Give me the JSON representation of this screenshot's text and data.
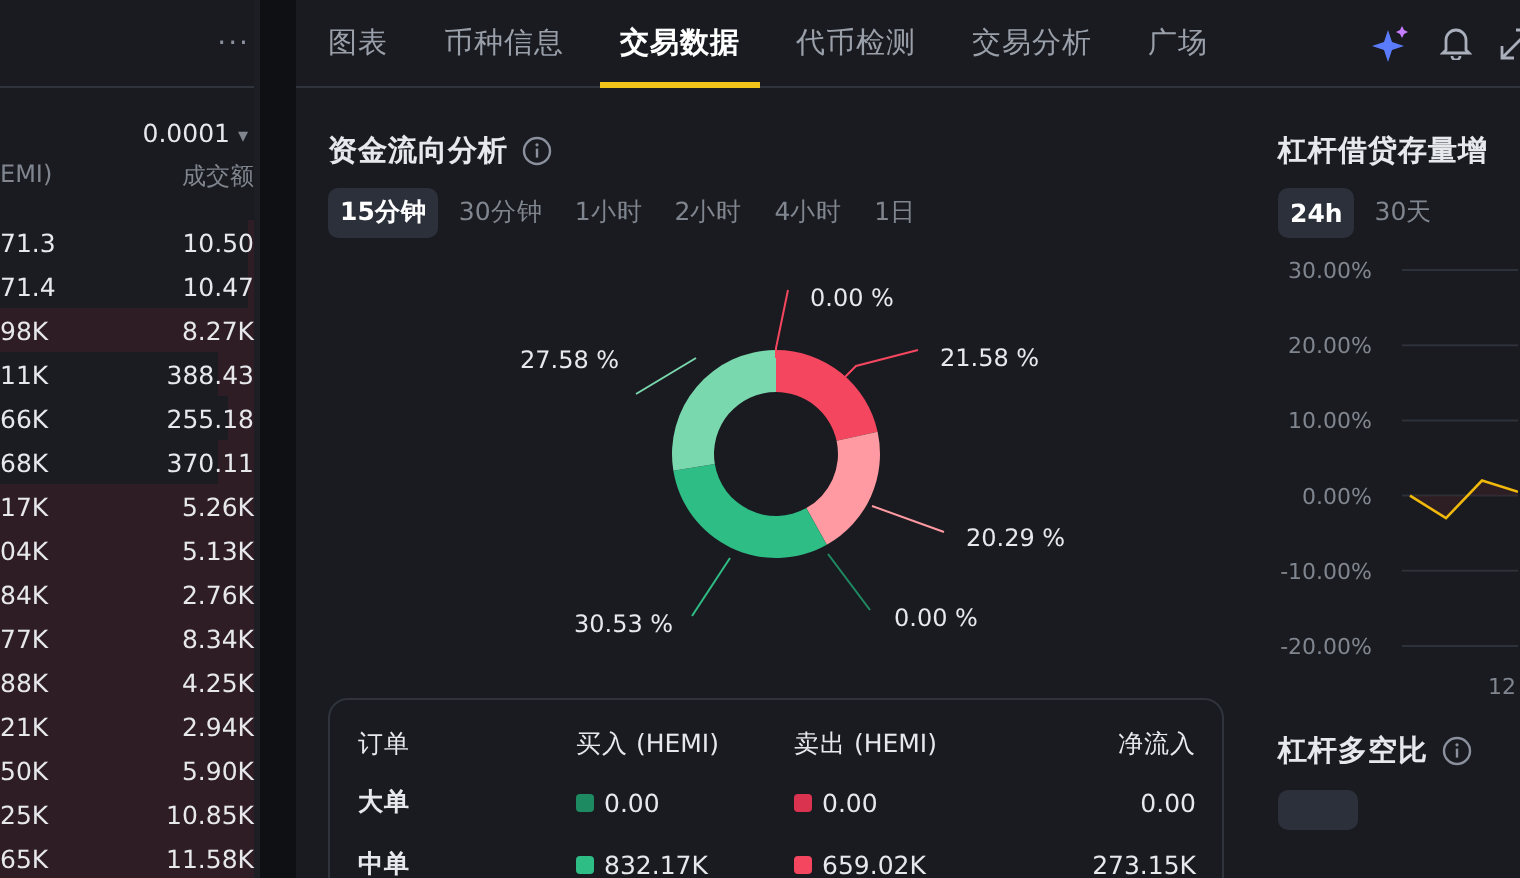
{
  "trades_panel": {
    "more": "···",
    "precision": "0.0001",
    "precision_caret": "▾",
    "columns": [
      "EMI)",
      "成交额"
    ],
    "rows": [
      {
        "qty": "71.3",
        "amount": "10.50",
        "level": 0.02
      },
      {
        "qty": "71.4",
        "amount": "10.47",
        "level": 0.02
      },
      {
        "qty": "98K",
        "amount": "8.27K",
        "level": 1
      },
      {
        "qty": "11K",
        "amount": "388.43",
        "level": 0.14
      },
      {
        "qty": "66K",
        "amount": "255.18",
        "level": 0.1
      },
      {
        "qty": "68K",
        "amount": "370.11",
        "level": 0.14
      },
      {
        "qty": "17K",
        "amount": "5.26K",
        "level": 1
      },
      {
        "qty": "04K",
        "amount": "5.13K",
        "level": 1
      },
      {
        "qty": "84K",
        "amount": "2.76K",
        "level": 1
      },
      {
        "qty": "77K",
        "amount": "8.34K",
        "level": 1
      },
      {
        "qty": "88K",
        "amount": "4.25K",
        "level": 1
      },
      {
        "qty": "21K",
        "amount": "2.94K",
        "level": 1
      },
      {
        "qty": "50K",
        "amount": "5.90K",
        "level": 1
      },
      {
        "qty": "25K",
        "amount": "10.85K",
        "level": 1
      },
      {
        "qty": "65K",
        "amount": "11.58K",
        "level": 1
      }
    ]
  },
  "tabs": [
    {
      "label": "图表",
      "selected": false
    },
    {
      "label": "币种信息",
      "selected": false
    },
    {
      "label": "交易数据",
      "selected": true
    },
    {
      "label": "代币检测",
      "selected": false
    },
    {
      "label": "交易分析",
      "selected": false
    },
    {
      "label": "广场",
      "selected": false
    }
  ],
  "fund_flow": {
    "title": "资金流向分析",
    "periods": [
      {
        "label": "15分钟",
        "selected": true
      },
      {
        "label": "30分钟",
        "selected": false
      },
      {
        "label": "1小时",
        "selected": false
      },
      {
        "label": "2小时",
        "selected": false
      },
      {
        "label": "4小时",
        "selected": false
      },
      {
        "label": "1日",
        "selected": false
      }
    ],
    "chart_data": {
      "type": "donut",
      "values": [
        0,
        21.58,
        20.29,
        0,
        30.53,
        27.58
      ],
      "value_labels": [
        "0.00 %",
        "21.58 %",
        "20.29 %",
        "0.00 %",
        "30.53 %",
        "27.58 %"
      ]
    },
    "table": {
      "columns": [
        "订单",
        "买入 (HEMI)",
        "卖出 (HEMI)",
        "净流入"
      ],
      "rows": [
        {
          "order": "大单",
          "buy": "0.00",
          "sell": "0.00",
          "net": "0.00"
        },
        {
          "order": "中单",
          "buy": "832.17K",
          "sell": "659.02K",
          "net": "273.15K"
        }
      ]
    }
  },
  "margin_growth": {
    "title": "杠杆借贷存量增",
    "periods": [
      {
        "label": "24h",
        "selected": true
      },
      {
        "label": "30天",
        "selected": false
      }
    ],
    "chart_data": {
      "type": "line",
      "series": [
        {
          "color": "#f0b90b",
          "values": [
            0,
            -3,
            2,
            0.5
          ]
        }
      ],
      "grid": true,
      "ylim": [
        -20,
        30
      ],
      "yticks": [
        {
          "value": 30,
          "label": "30.00%"
        },
        {
          "value": 20,
          "label": "20.00%"
        },
        {
          "value": 10,
          "label": "10.00%"
        },
        {
          "value": 0,
          "label": "0.00%"
        },
        {
          "value": -10,
          "label": "-10.00%"
        },
        {
          "value": -20,
          "label": "-20.00%"
        }
      ]
    },
    "x_axis_text": "12"
  },
  "long_short": {
    "title": "杠杆多空比"
  }
}
